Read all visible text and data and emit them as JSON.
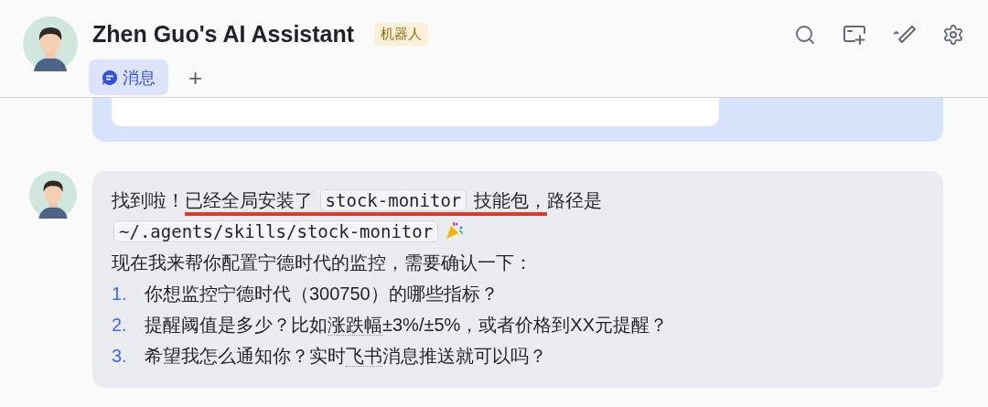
{
  "header": {
    "title": "Zhen Guo's AI Assistant",
    "badge": "机器人",
    "tabs": [
      {
        "label": "消息",
        "selected": true
      }
    ],
    "add_tab": "+"
  },
  "messages": [
    {
      "kind": "card"
    },
    {
      "kind": "reply",
      "lines": [
        {
          "segments": [
            {
              "kind": "text",
              "text": "找到啦！",
              "marked": false
            },
            {
              "kind": "text",
              "text": "已经全局安装了 ",
              "marked": true
            },
            {
              "kind": "code",
              "text": "stock-monitor",
              "marked": true
            },
            {
              "kind": "text",
              "text": " 技能包，",
              "marked": true
            },
            {
              "kind": "text",
              "text": "路径是",
              "marked": false
            }
          ]
        },
        {
          "segments": [
            {
              "kind": "code",
              "text": "~/.agents/skills/stock-monitor",
              "marked": false
            },
            {
              "kind": "emoji",
              "marked": false
            }
          ]
        },
        {
          "segments": [
            {
              "kind": "text",
              "text": "现在我来帮你配置宁德时代的监控，需要确认一下：",
              "marked": false
            }
          ]
        }
      ],
      "items": [
        {
          "number": "1.",
          "segments": [
            {
              "kind": "text",
              "text": "你想监控宁德时代（300750）的哪些指标？"
            }
          ]
        },
        {
          "number": "2.",
          "segments": [
            {
              "kind": "text",
              "text": "提醒阈值是多少？比如"
            },
            {
              "kind": "term",
              "text": "涨跌幅"
            },
            {
              "kind": "text",
              "text": "±3%/±5%，或者价格到XX元提醒？"
            }
          ]
        },
        {
          "number": "3.",
          "segments": [
            {
              "kind": "text",
              "text": "希望我怎么通知你？实时"
            },
            {
              "kind": "term",
              "text": "飞书"
            },
            {
              "kind": "text",
              "text": "消息推送就可以吗？"
            }
          ]
        }
      ]
    }
  ]
}
